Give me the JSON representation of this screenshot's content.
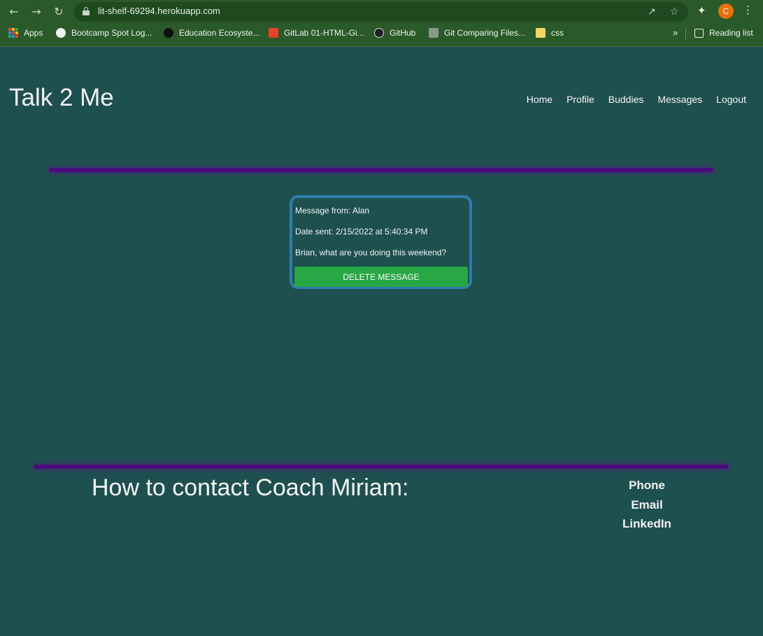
{
  "browser": {
    "url": "lit-shelf-69294.herokuapp.com",
    "profile_initial": "C",
    "bookmarks": [
      {
        "label": "Apps",
        "icon": "apps-grid-icon"
      },
      {
        "label": "Bootcamp Spot Log...",
        "icon": "globe-icon"
      },
      {
        "label": "Education Ecosyste...",
        "icon": "edu-icon"
      },
      {
        "label": "GitLab 01-HTML-Gi...",
        "icon": "gitlab-icon"
      },
      {
        "label": "GitHub",
        "icon": "github-icon"
      },
      {
        "label": "Git Comparing Files...",
        "icon": "git-icon"
      },
      {
        "label": "css",
        "icon": "folder-icon"
      }
    ],
    "reading_list": "Reading list"
  },
  "header": {
    "brand": "Talk 2 Me",
    "nav": [
      "Home",
      "Profile",
      "Buddies",
      "Messages",
      "Logout"
    ]
  },
  "message": {
    "from": "Message from: Alan",
    "date": "Date sent: 2/15/2022 at 5:40:34 PM",
    "body": "Brian, what are you doing this weekend?",
    "delete_label": "DELETE MESSAGE"
  },
  "footer": {
    "title": "How to contact Coach Miriam:",
    "links": [
      "Phone",
      "Email",
      "LinkedIn"
    ]
  },
  "colors": {
    "background": "#1f5050",
    "divider": "#4b0a7d",
    "card_border": "#2f7dae",
    "delete_button": "#28a745"
  }
}
